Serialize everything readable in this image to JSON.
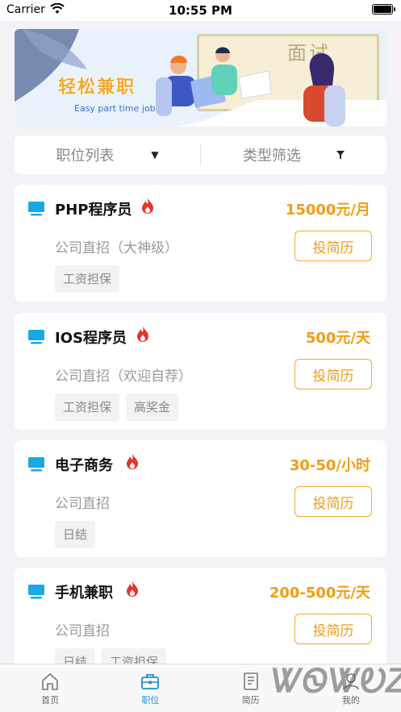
{
  "status_bar": {
    "carrier": "Carrier",
    "time": "10:55 PM"
  },
  "banner": {
    "board_text": "面试",
    "slogan": "轻松兼职",
    "subtitle": "Easy part time job"
  },
  "filters": [
    {
      "label": "职位列表",
      "icon": "triangle-down-icon"
    },
    {
      "label": "类型筛选",
      "icon": "funnel-icon"
    }
  ],
  "jobs": [
    {
      "title": "PHP程序员",
      "salary": "15000元/月",
      "company": "公司直招（大神级）",
      "apply_label": "投简历",
      "tags": [
        "工资担保"
      ]
    },
    {
      "title": "IOS程序员",
      "salary": "500元/天",
      "company": "公司直招（欢迎自荐）",
      "apply_label": "投简历",
      "tags": [
        "工资担保",
        "高奖金"
      ]
    },
    {
      "title": "电子商务",
      "salary": "30-50/小时",
      "company": "公司直招",
      "apply_label": "投简历",
      "tags": [
        "日结"
      ]
    },
    {
      "title": "手机兼职",
      "salary": "200-500元/天",
      "company": "公司直招",
      "apply_label": "投简历",
      "tags": [
        "日结",
        "工资担保"
      ]
    }
  ],
  "tab_bar": {
    "tabs": [
      {
        "label": "首页",
        "icon": "home-icon",
        "active": false
      },
      {
        "label": "职位",
        "icon": "briefcase-icon",
        "active": true
      },
      {
        "label": "简历",
        "icon": "resume-icon",
        "active": false
      },
      {
        "label": "我的",
        "icon": "profile-icon",
        "active": false
      }
    ]
  },
  "watermark": "ᏔᏫᏔᎧᏃ",
  "colors": {
    "accent": "#f39c12",
    "active_tab": "#1a8fd8",
    "monitor_icon": "#1aa7e8",
    "fire_icon": "#e8322b"
  }
}
